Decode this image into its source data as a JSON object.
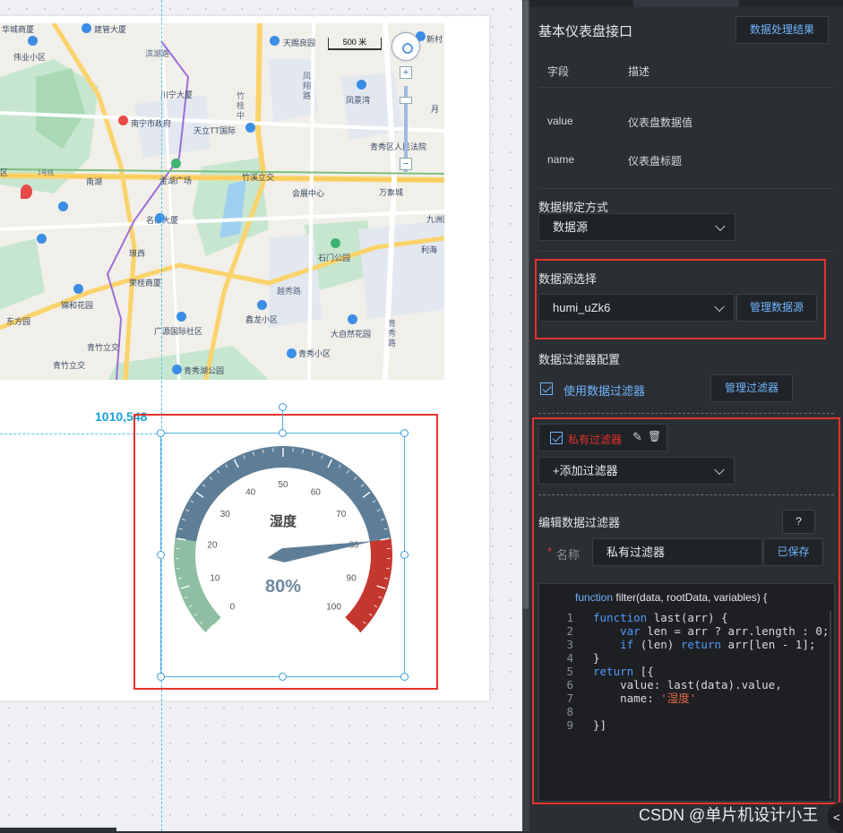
{
  "canvas": {
    "coord_label": "1010,548",
    "map": {
      "scale_label": "500 米",
      "zoom_in": "+",
      "zoom_out": "−",
      "labels": [
        {
          "text": "华城商厦"
        },
        {
          "text": "建管大厦"
        },
        {
          "text": "伟业小区"
        },
        {
          "text": "滨湖路"
        },
        {
          "text": "天赐良园"
        },
        {
          "text": "新村"
        },
        {
          "text": "凤"
        },
        {
          "text": "翔"
        },
        {
          "text": "路"
        },
        {
          "text": "凤景湾"
        },
        {
          "text": "川宁大厦"
        },
        {
          "text": "南宁市政府"
        },
        {
          "text": "天立TT国际"
        },
        {
          "text": "青秀区人民法院"
        },
        {
          "text": "月"
        },
        {
          "text": "南湖"
        },
        {
          "text": "金湖广场"
        },
        {
          "text": "竹溪立交"
        },
        {
          "text": "会展中心"
        },
        {
          "text": "万象城"
        },
        {
          "text": "九洲国"
        },
        {
          "text": "名都大厦"
        },
        {
          "text": "琅西"
        },
        {
          "text": "石门公园"
        },
        {
          "text": "利海"
        },
        {
          "text": "荣桂商厦"
        },
        {
          "text": "越秀路"
        },
        {
          "text": "锦和花园"
        },
        {
          "text": "鑫龙小区"
        },
        {
          "text": "东方园"
        },
        {
          "text": "广源国际社区"
        },
        {
          "text": "大自然花园"
        },
        {
          "text": "青"
        },
        {
          "text": "秀"
        },
        {
          "text": "路"
        },
        {
          "text": "青竹立交"
        },
        {
          "text": "青秀小区"
        },
        {
          "text": "青竹立交"
        },
        {
          "text": "青秀湖公园"
        },
        {
          "text": "1号线"
        },
        {
          "text": "竹"
        },
        {
          "text": "桂"
        },
        {
          "text": "中"
        },
        {
          "text": "区"
        }
      ]
    },
    "gauge": {
      "title": "湿度",
      "value": 80,
      "value_label": "80%",
      "ticks": [
        "0",
        "10",
        "20",
        "30",
        "40",
        "50",
        "60",
        "70",
        "80",
        "90",
        "100"
      ],
      "colors": {
        "low": "#8fbfa3",
        "mid": "#5e7e97",
        "high": "#c4372f"
      }
    }
  },
  "panel": {
    "title": "基本仪表盘接口",
    "result_button": "数据处理结果",
    "table": {
      "headers": [
        "字段",
        "描述"
      ],
      "rows": [
        {
          "field": "value",
          "desc": "仪表盘数据值"
        },
        {
          "field": "name",
          "desc": "仪表盘标题"
        }
      ]
    },
    "binding_label": "数据绑定方式",
    "binding_value": "数据源",
    "source_label": "数据源选择",
    "source_value": "humi_uZk6",
    "manage_source_button": "管理数据源",
    "filter_config_label": "数据过滤器配置",
    "use_filter_label": "使用数据过滤器",
    "manage_filter_button": "管理过滤器",
    "private_filter_label": "私有过滤器",
    "add_filter_label": "+添加过滤器",
    "edit_filter_label": "编辑数据过滤器",
    "help_button": "?",
    "name_field_label": "名称",
    "name_field_value": "私有过滤器",
    "saved_button": "已保存",
    "code": {
      "header_kw": "function",
      "header_rest": " filter(data, rootData, variables) {",
      "lines": [
        "function last(arr) {",
        "    var len = arr ? arr.length : 0;",
        "    if (len) return arr[len - 1];",
        "}",
        "return [{",
        "    value: last(data).value,",
        "    name: '湿度'",
        "",
        "}]"
      ]
    }
  },
  "watermark": "CSDN @单片机设计小王"
}
